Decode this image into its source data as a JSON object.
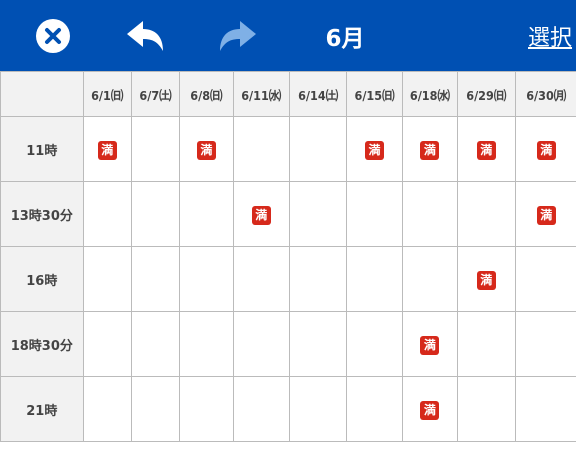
{
  "header": {
    "title": "6月",
    "select_label": "選択",
    "accent": "#0050b3"
  },
  "calendar": {
    "dates": [
      "6/1㈰",
      "6/7㈯",
      "6/8㈰",
      "6/11㈬",
      "6/14㈯",
      "6/15㈰",
      "6/18㈬",
      "6/29㈰",
      "6/30㈪"
    ],
    "times": [
      "11時",
      "13時30分",
      "16時",
      "18時30分",
      "21時"
    ],
    "full_label": "満",
    "full_color": "#d6291b",
    "cells": [
      [
        true,
        false,
        true,
        false,
        false,
        true,
        true,
        true,
        true
      ],
      [
        false,
        false,
        false,
        true,
        false,
        false,
        false,
        false,
        true
      ],
      [
        false,
        false,
        false,
        false,
        false,
        false,
        false,
        true,
        false
      ],
      [
        false,
        false,
        false,
        false,
        false,
        false,
        true,
        false,
        false
      ],
      [
        false,
        false,
        false,
        false,
        false,
        false,
        true,
        false,
        false
      ]
    ]
  }
}
